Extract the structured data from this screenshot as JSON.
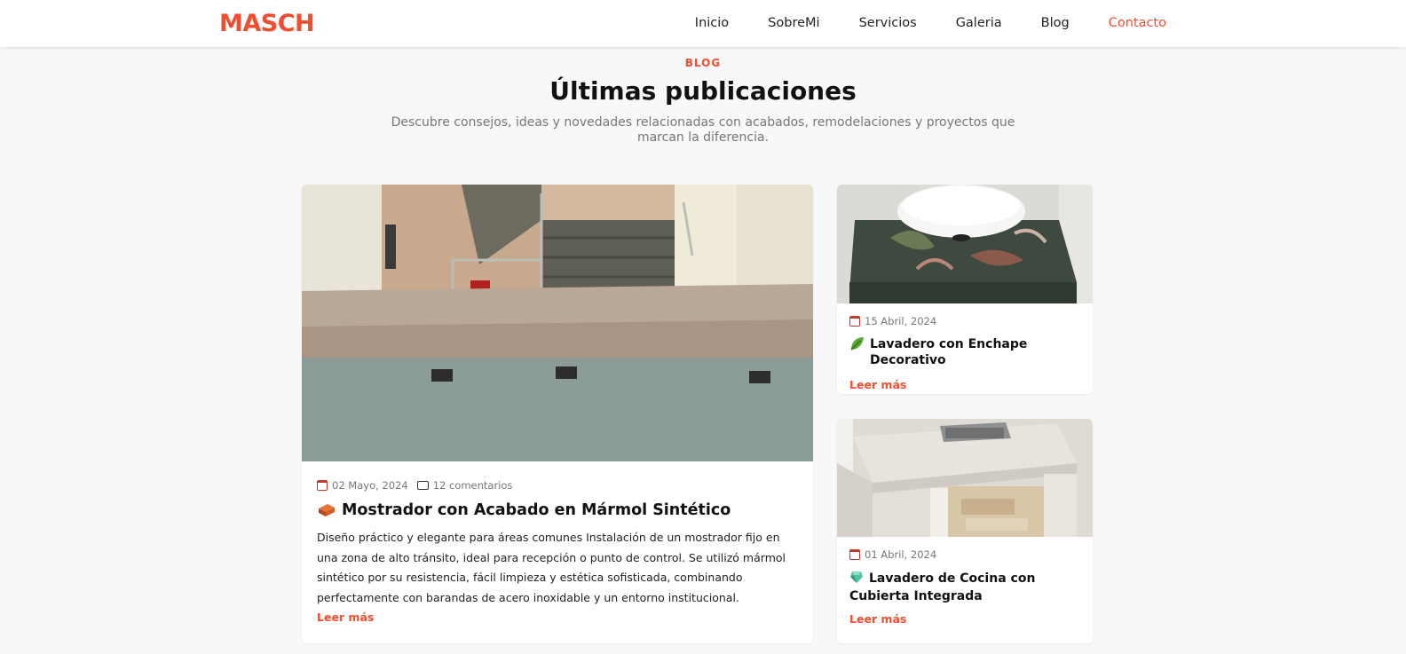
{
  "brand": {
    "logo": "MASCH",
    "accent_color": "#f04e30"
  },
  "nav": {
    "items": [
      {
        "label": "Inicio"
      },
      {
        "label": "SobreMi"
      },
      {
        "label": "Servicios"
      },
      {
        "label": "Galeria"
      },
      {
        "label": "Blog"
      },
      {
        "label": "Contacto",
        "active": true
      }
    ]
  },
  "section": {
    "tag": "BLOG",
    "title": "Últimas publicaciones",
    "description": "Descubre consejos, ideas y novedades relacionadas con acabados, remodelaciones y proyectos que marcan la diferencia."
  },
  "posts": {
    "featured": {
      "date": "02 Mayo, 2024",
      "comments": "12 comentarios",
      "icon": "brick-icon",
      "title": "Mostrador con Acabado en Mármol Sintético",
      "excerpt": "Diseño práctico y elegante para áreas comunes Instalación de un mostrador fijo en una zona de alto tránsito, ideal para recepción o punto de control. Se utilizó mármol sintético por su resistencia, fácil limpieza y estética sofisticada, combinando perfectamente con barandas de acero inoxidable y un entorno institucional.",
      "read_more": "Leer más"
    },
    "side": [
      {
        "date": "15 Abril, 2024",
        "icon": "leaf-icon",
        "title": "Lavadero con Enchape Decorativo",
        "read_more": "Leer más"
      },
      {
        "date": "01 Abril, 2024",
        "icon": "gem-icon",
        "title": "Lavadero de Cocina con Cubierta Integrada",
        "read_more": "Leer más"
      }
    ]
  }
}
